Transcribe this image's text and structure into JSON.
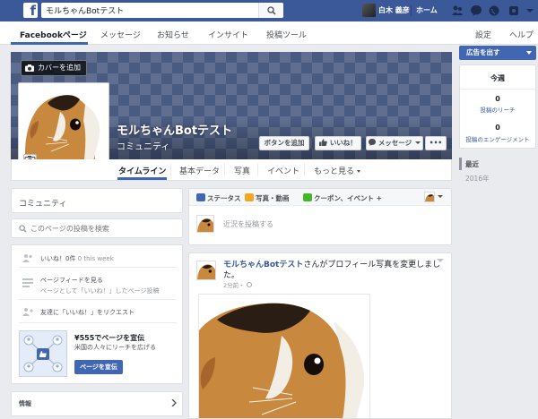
{
  "topbar": {
    "logo": "f",
    "search_value": "モルちゃんBotテスト",
    "user_name": "白木 義彦",
    "home_label": "ホーム"
  },
  "pagenav": {
    "items": [
      "Facebookページ",
      "メッセージ",
      "お知らせ",
      "インサイト",
      "投稿ツール"
    ],
    "right": [
      "設定",
      "ヘルプ"
    ]
  },
  "cover": {
    "add_cover_label": "カバーを追加",
    "page_name": "モルちゃんBotテスト",
    "category": "コミュニティ",
    "buttons": {
      "add_button": "ボタンを追加",
      "like": "いいね！",
      "message": "メッセージ",
      "more": "•••"
    }
  },
  "tabs": [
    "タイムライン",
    "基本データ",
    "写真",
    "イベント",
    "もっと見る"
  ],
  "right_sidebar": {
    "ad_button": "広告を出す",
    "week_title": "今週",
    "reach_value": "0",
    "reach_label": "投稿のリーチ",
    "engagement_value": "0",
    "engagement_label": "投稿のエンゲージメント",
    "timeline_current": "最近",
    "timeline_year": "2016年"
  },
  "left": {
    "community_label": "コミュニティ",
    "search_placeholder": "このページの投稿を検索",
    "likes_count": "いいね！0件",
    "likes_week": "0 this week",
    "feed_title": "ページフィードを見る",
    "feed_sub": "ページとして「いいね！」したページ投稿",
    "invite": "友達に「いいね！」をリクエスト",
    "promo_title": "¥555でページを宣伝",
    "promo_sub": "米国の人々にリーチを広げる",
    "promo_button": "ページを宣伝",
    "info_label": "情報"
  },
  "composer": {
    "tabs": [
      "ステータス",
      "写真・動画",
      "クーポン、イベント +"
    ],
    "placeholder": "近況を投稿する"
  },
  "post": {
    "author": "モルちゃんBotテスト",
    "action_text": "さんがプロフィール写真を変更しました。",
    "time": "2分前・"
  },
  "colors": {
    "brand_blue": "#3b5998",
    "accent_blue": "#4267b2",
    "link_blue": "#365899",
    "background": "#e9ebee"
  }
}
